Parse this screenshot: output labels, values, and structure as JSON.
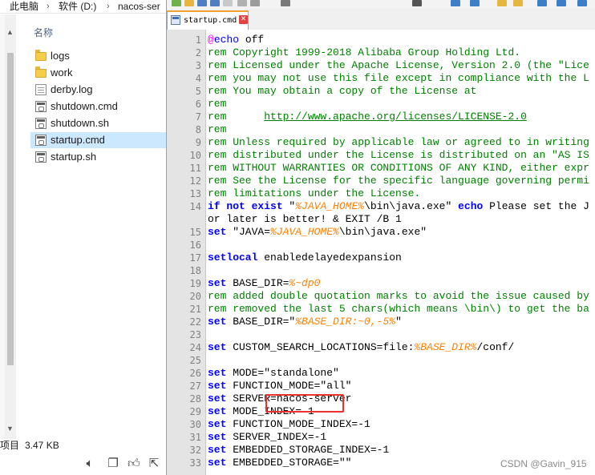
{
  "explorer": {
    "breadcrumb": [
      "此电脑",
      "软件 (D:)",
      "nacos-ser"
    ],
    "column_header": "名称",
    "files": [
      {
        "name": "logs",
        "type": "folder"
      },
      {
        "name": "work",
        "type": "folder"
      },
      {
        "name": "derby.log",
        "type": "document"
      },
      {
        "name": "shutdown.cmd",
        "type": "script"
      },
      {
        "name": "shutdown.sh",
        "type": "script"
      },
      {
        "name": "startup.cmd",
        "type": "script",
        "selected": true
      },
      {
        "name": "startup.sh",
        "type": "script"
      }
    ],
    "status": {
      "count": "项目",
      "size": "3.47 KB"
    },
    "bottom_icons": [
      "speaker-icon",
      "copy-icon",
      "thumbs-up-icon",
      "share-icon",
      "more-icon"
    ]
  },
  "editor": {
    "tab_label": "startup.cmd",
    "tab_close": "✕",
    "line_numbers": [
      "1",
      "2",
      "3",
      "4",
      "5",
      "6",
      "7",
      "8",
      "9",
      "10",
      "11",
      "12",
      "13",
      "14",
      "",
      "15",
      "16",
      "17",
      "18",
      "19",
      "20",
      "21",
      "22",
      "23",
      "24",
      "25",
      "26",
      "27",
      "28",
      "29",
      "30",
      "31",
      "32",
      "33"
    ],
    "lines": [
      [
        {
          "c": "at",
          "t": "@"
        },
        {
          "c": "kw2",
          "t": "echo"
        },
        {
          "c": "plain",
          "t": " off"
        }
      ],
      [
        {
          "c": "rem",
          "t": "rem Copyright 1999-2018 Alibaba Group Holding Ltd."
        }
      ],
      [
        {
          "c": "rem",
          "t": "rem Licensed under the Apache License, Version 2.0 (the \"Lice"
        }
      ],
      [
        {
          "c": "rem",
          "t": "rem you may not use this file except in compliance with the L"
        }
      ],
      [
        {
          "c": "rem",
          "t": "rem You may obtain a copy of the License at"
        }
      ],
      [
        {
          "c": "rem",
          "t": "rem"
        }
      ],
      [
        {
          "c": "rem",
          "t": "rem      "
        },
        {
          "c": "url",
          "t": "http://www.apache.org/licenses/LICENSE-2.0"
        }
      ],
      [
        {
          "c": "rem",
          "t": "rem"
        }
      ],
      [
        {
          "c": "rem",
          "t": "rem Unless required by applicable law or agreed to in writing"
        }
      ],
      [
        {
          "c": "rem",
          "t": "rem distributed under the License is distributed on an \"AS IS"
        }
      ],
      [
        {
          "c": "rem",
          "t": "rem WITHOUT WARRANTIES OR CONDITIONS OF ANY KIND, either expr"
        }
      ],
      [
        {
          "c": "rem",
          "t": "rem See the License for the specific language governing permi"
        }
      ],
      [
        {
          "c": "rem",
          "t": "rem limitations under the License."
        }
      ],
      [
        {
          "c": "kw",
          "t": "if not exist"
        },
        {
          "c": "plain",
          "t": " \""
        },
        {
          "c": "var",
          "t": "%JAVA_HOME%"
        },
        {
          "c": "plain",
          "t": "\\bin\\java.exe\" "
        },
        {
          "c": "kw",
          "t": "echo"
        },
        {
          "c": "plain",
          "t": " Please set the J"
        }
      ],
      [
        {
          "c": "plain",
          "t": "or later is better! & EXIT /B 1"
        }
      ],
      [
        {
          "c": "kw",
          "t": "set"
        },
        {
          "c": "plain",
          "t": " \"JAVA="
        },
        {
          "c": "var",
          "t": "%JAVA_HOME%"
        },
        {
          "c": "plain",
          "t": "\\bin\\java.exe\""
        }
      ],
      [],
      [
        {
          "c": "kw",
          "t": "setlocal"
        },
        {
          "c": "plain",
          "t": " enabledelayedexpansion"
        }
      ],
      [],
      [
        {
          "c": "kw",
          "t": "set"
        },
        {
          "c": "plain",
          "t": " BASE_DIR="
        },
        {
          "c": "var",
          "t": "%~dp0"
        }
      ],
      [
        {
          "c": "rem",
          "t": "rem added double quotation marks to avoid the issue caused by"
        }
      ],
      [
        {
          "c": "rem",
          "t": "rem removed the last 5 chars(which means \\bin\\) to get the ba"
        }
      ],
      [
        {
          "c": "kw",
          "t": "set"
        },
        {
          "c": "plain",
          "t": " BASE_DIR=\""
        },
        {
          "c": "var",
          "t": "%BASE_DIR:~0,-5%"
        },
        {
          "c": "plain",
          "t": "\""
        }
      ],
      [],
      [
        {
          "c": "kw",
          "t": "set"
        },
        {
          "c": "plain",
          "t": " CUSTOM_SEARCH_LOCATIONS=file:"
        },
        {
          "c": "var",
          "t": "%BASE_DIR%"
        },
        {
          "c": "plain",
          "t": "/conf/"
        }
      ],
      [],
      [
        {
          "c": "kw",
          "t": "set"
        },
        {
          "c": "plain",
          "t": " MODE=\"standalone\""
        }
      ],
      [
        {
          "c": "kw",
          "t": "set"
        },
        {
          "c": "plain",
          "t": " FUNCTION_MODE=\"all\""
        }
      ],
      [
        {
          "c": "kw",
          "t": "set"
        },
        {
          "c": "plain",
          "t": " SERVER=nacos-server"
        }
      ],
      [
        {
          "c": "kw",
          "t": "set"
        },
        {
          "c": "plain",
          "t": " MODE_INDEX=-1"
        }
      ],
      [
        {
          "c": "kw",
          "t": "set"
        },
        {
          "c": "plain",
          "t": " FUNCTION_MODE_INDEX=-1"
        }
      ],
      [
        {
          "c": "kw",
          "t": "set"
        },
        {
          "c": "plain",
          "t": " SERVER_INDEX=-1"
        }
      ],
      [
        {
          "c": "kw",
          "t": "set"
        },
        {
          "c": "plain",
          "t": " EMBEDDED_STORAGE_INDEX=-1"
        }
      ],
      [
        {
          "c": "kw",
          "t": "set"
        },
        {
          "c": "plain",
          "t": " EMBEDDED_STORAGE=\"\""
        }
      ]
    ]
  },
  "watermark": "CSDN @Gavin_915",
  "colors": {
    "keyword": "#0000ff",
    "comment": "#008000",
    "variable": "#ff8000",
    "highlight": "#e8322b",
    "selection": "#cce8ff"
  }
}
